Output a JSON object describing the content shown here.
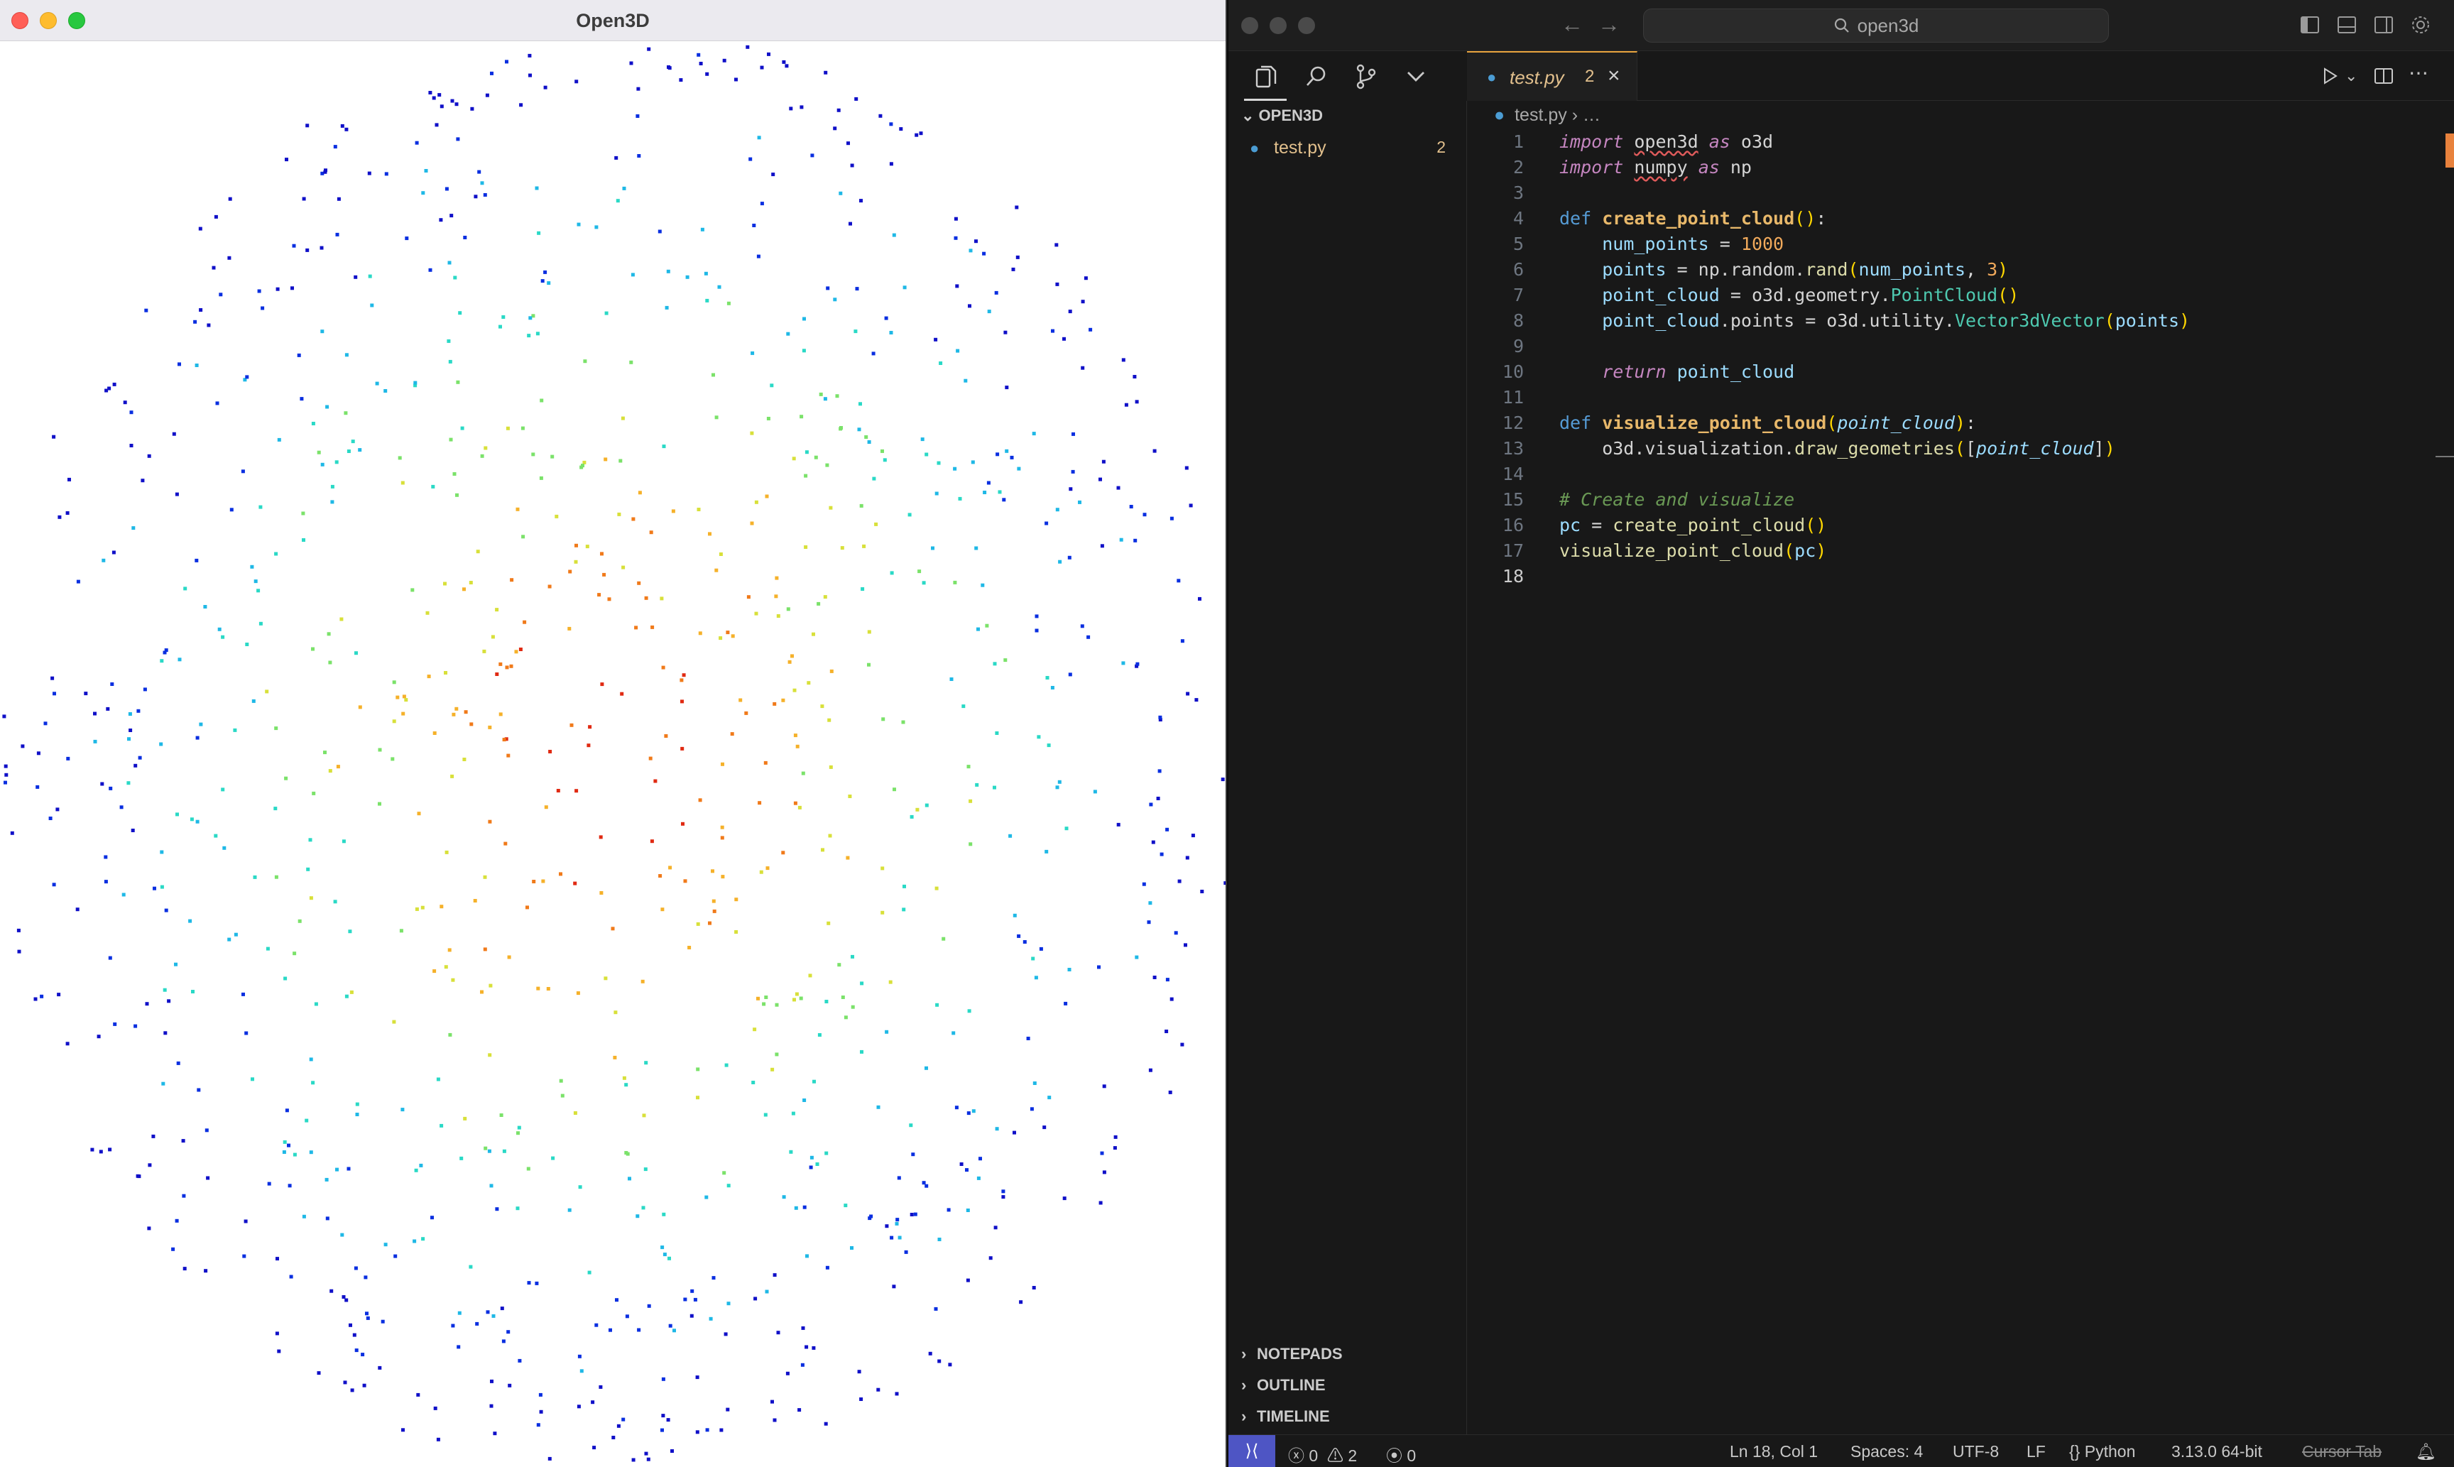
{
  "open3d": {
    "title": "Open3D"
  },
  "editor": {
    "search_text": "open3d",
    "folder_title": "OPEN3D",
    "file": {
      "name": "test.py",
      "problems": "2"
    },
    "tab": {
      "name": "test.py",
      "problems": "2"
    },
    "breadcrumb": {
      "file": "test.py",
      "rest": "…"
    },
    "panels": [
      "NOTEPADS",
      "OUTLINE",
      "TIMELINE"
    ],
    "active_line": "18",
    "code_lines": [
      "import open3d as o3d",
      "import numpy as np",
      "",
      "def create_point_cloud():",
      "    num_points = 1000",
      "    points = np.random.rand(num_points, 3)",
      "    point_cloud = o3d.geometry.PointCloud()",
      "    point_cloud.points = o3d.utility.Vector3dVector(points)",
      "",
      "    return point_cloud",
      "",
      "def visualize_point_cloud(point_cloud):",
      "    o3d.visualization.draw_geometries([point_cloud])",
      "",
      "# Create and visualize",
      "pc = create_point_cloud()",
      "visualize_point_cloud(pc)",
      ""
    ],
    "status": {
      "errors": "0",
      "warnings": "2",
      "ports": "0",
      "position": "Ln 18, Col 1",
      "spaces": "Spaces: 4",
      "encoding": "UTF-8",
      "eol": "LF",
      "language": "Python",
      "interpreter": "3.13.0 64-bit",
      "cursor_tab": "Cursor Tab"
    }
  },
  "colors": {
    "accent_tab": "#e8a33d",
    "remote": "#4e55c4",
    "point_palette": [
      "#1010c8",
      "#0a2fe0",
      "#1fb8e6",
      "#2ad9c6",
      "#7be26a",
      "#d8e03a",
      "#f5b12a",
      "#f07a1a",
      "#e02a12"
    ]
  }
}
